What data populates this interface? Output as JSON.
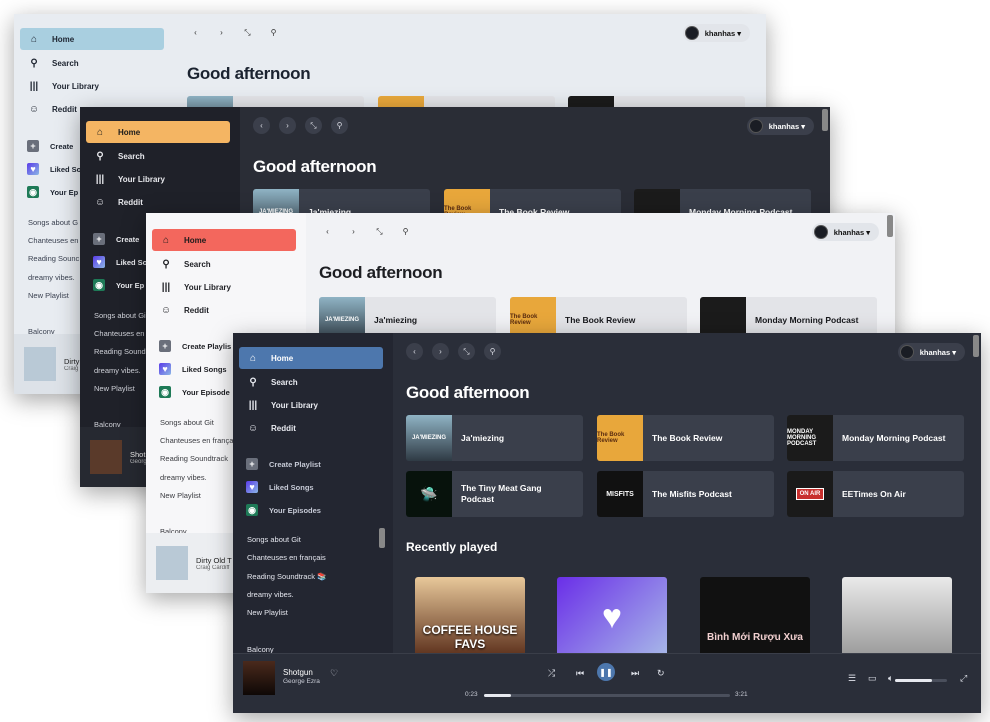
{
  "user": {
    "name": "khanhas"
  },
  "nav": {
    "home": "Home",
    "search": "Search",
    "library": "Your Library",
    "reddit": "Reddit"
  },
  "library": {
    "create": "Create Playlist",
    "liked": "Liked Songs",
    "episodes": "Your Episodes"
  },
  "library_short": {
    "create": "Create",
    "liked": "Liked So",
    "episodes": "Your Ep",
    "create_playlist": "Create Playlis",
    "episodes_cut": "Your Episode"
  },
  "playlists": [
    "Songs about Git",
    "Chanteuses en français",
    "Reading Soundtrack 📚",
    "dreamy vibes.",
    "New Playlist",
    "Balcony"
  ],
  "playlists_short_w1": [
    "Songs about G",
    "Chanteuses en",
    "Reading Sounc",
    "dreamy vibes.",
    "New Playlist",
    "Balcony"
  ],
  "playlists_short_w2": [
    "Songs about Gi",
    "Chanteuses en",
    "Reading Sound",
    "dreamy vibes.",
    "New Playlist",
    "Balcony"
  ],
  "playlists_short_w3": [
    "Songs about Git",
    "Chanteuses en françai",
    "Reading Soundtrack",
    "dreamy vibes.",
    "New Playlist",
    "Balcony"
  ],
  "greeting": "Good afternoon",
  "shortcuts": [
    {
      "title": "Ja'miezing",
      "thumb": "JA'MIEZING"
    },
    {
      "title": "The Book Review",
      "thumb": "The Book Review"
    },
    {
      "title": "Monday Morning Podcast",
      "thumb": "MONDAY MORNING PODCAST"
    },
    {
      "title": "The Tiny Meat Gang Podcast",
      "thumb": "🛸"
    },
    {
      "title": "The Misfits Podcast",
      "thumb": "MISFITS"
    },
    {
      "title": "EETimes On Air",
      "thumb": "ON AIR"
    }
  ],
  "recently_played": {
    "title": "Recently played",
    "cards": [
      {
        "label": "COFFEE HOUSE FAVS"
      },
      {
        "label": "♥"
      },
      {
        "label": "Bình Mới Rượu Xưa"
      },
      {
        "label": ""
      }
    ]
  },
  "now_playing_w4": {
    "title": "Shotgun",
    "artist": "George Ezra"
  },
  "now_playing_w1": {
    "title": "Dirty",
    "artist": "Craig"
  },
  "now_playing_w2": {
    "title": "Shot",
    "artist": "George"
  },
  "now_playing_w3": {
    "title": "Dirty Old T",
    "artist": "Craig Cardiff"
  },
  "player": {
    "elapsed": "0:23",
    "duration": "3:21",
    "progress": 0.11,
    "volume": 0.72
  },
  "colors": {
    "w1_accent": "#a9cfe0",
    "w2_accent": "#f4b563",
    "w3_accent": "#f3675d",
    "w4_accent": "#4d77ad"
  }
}
